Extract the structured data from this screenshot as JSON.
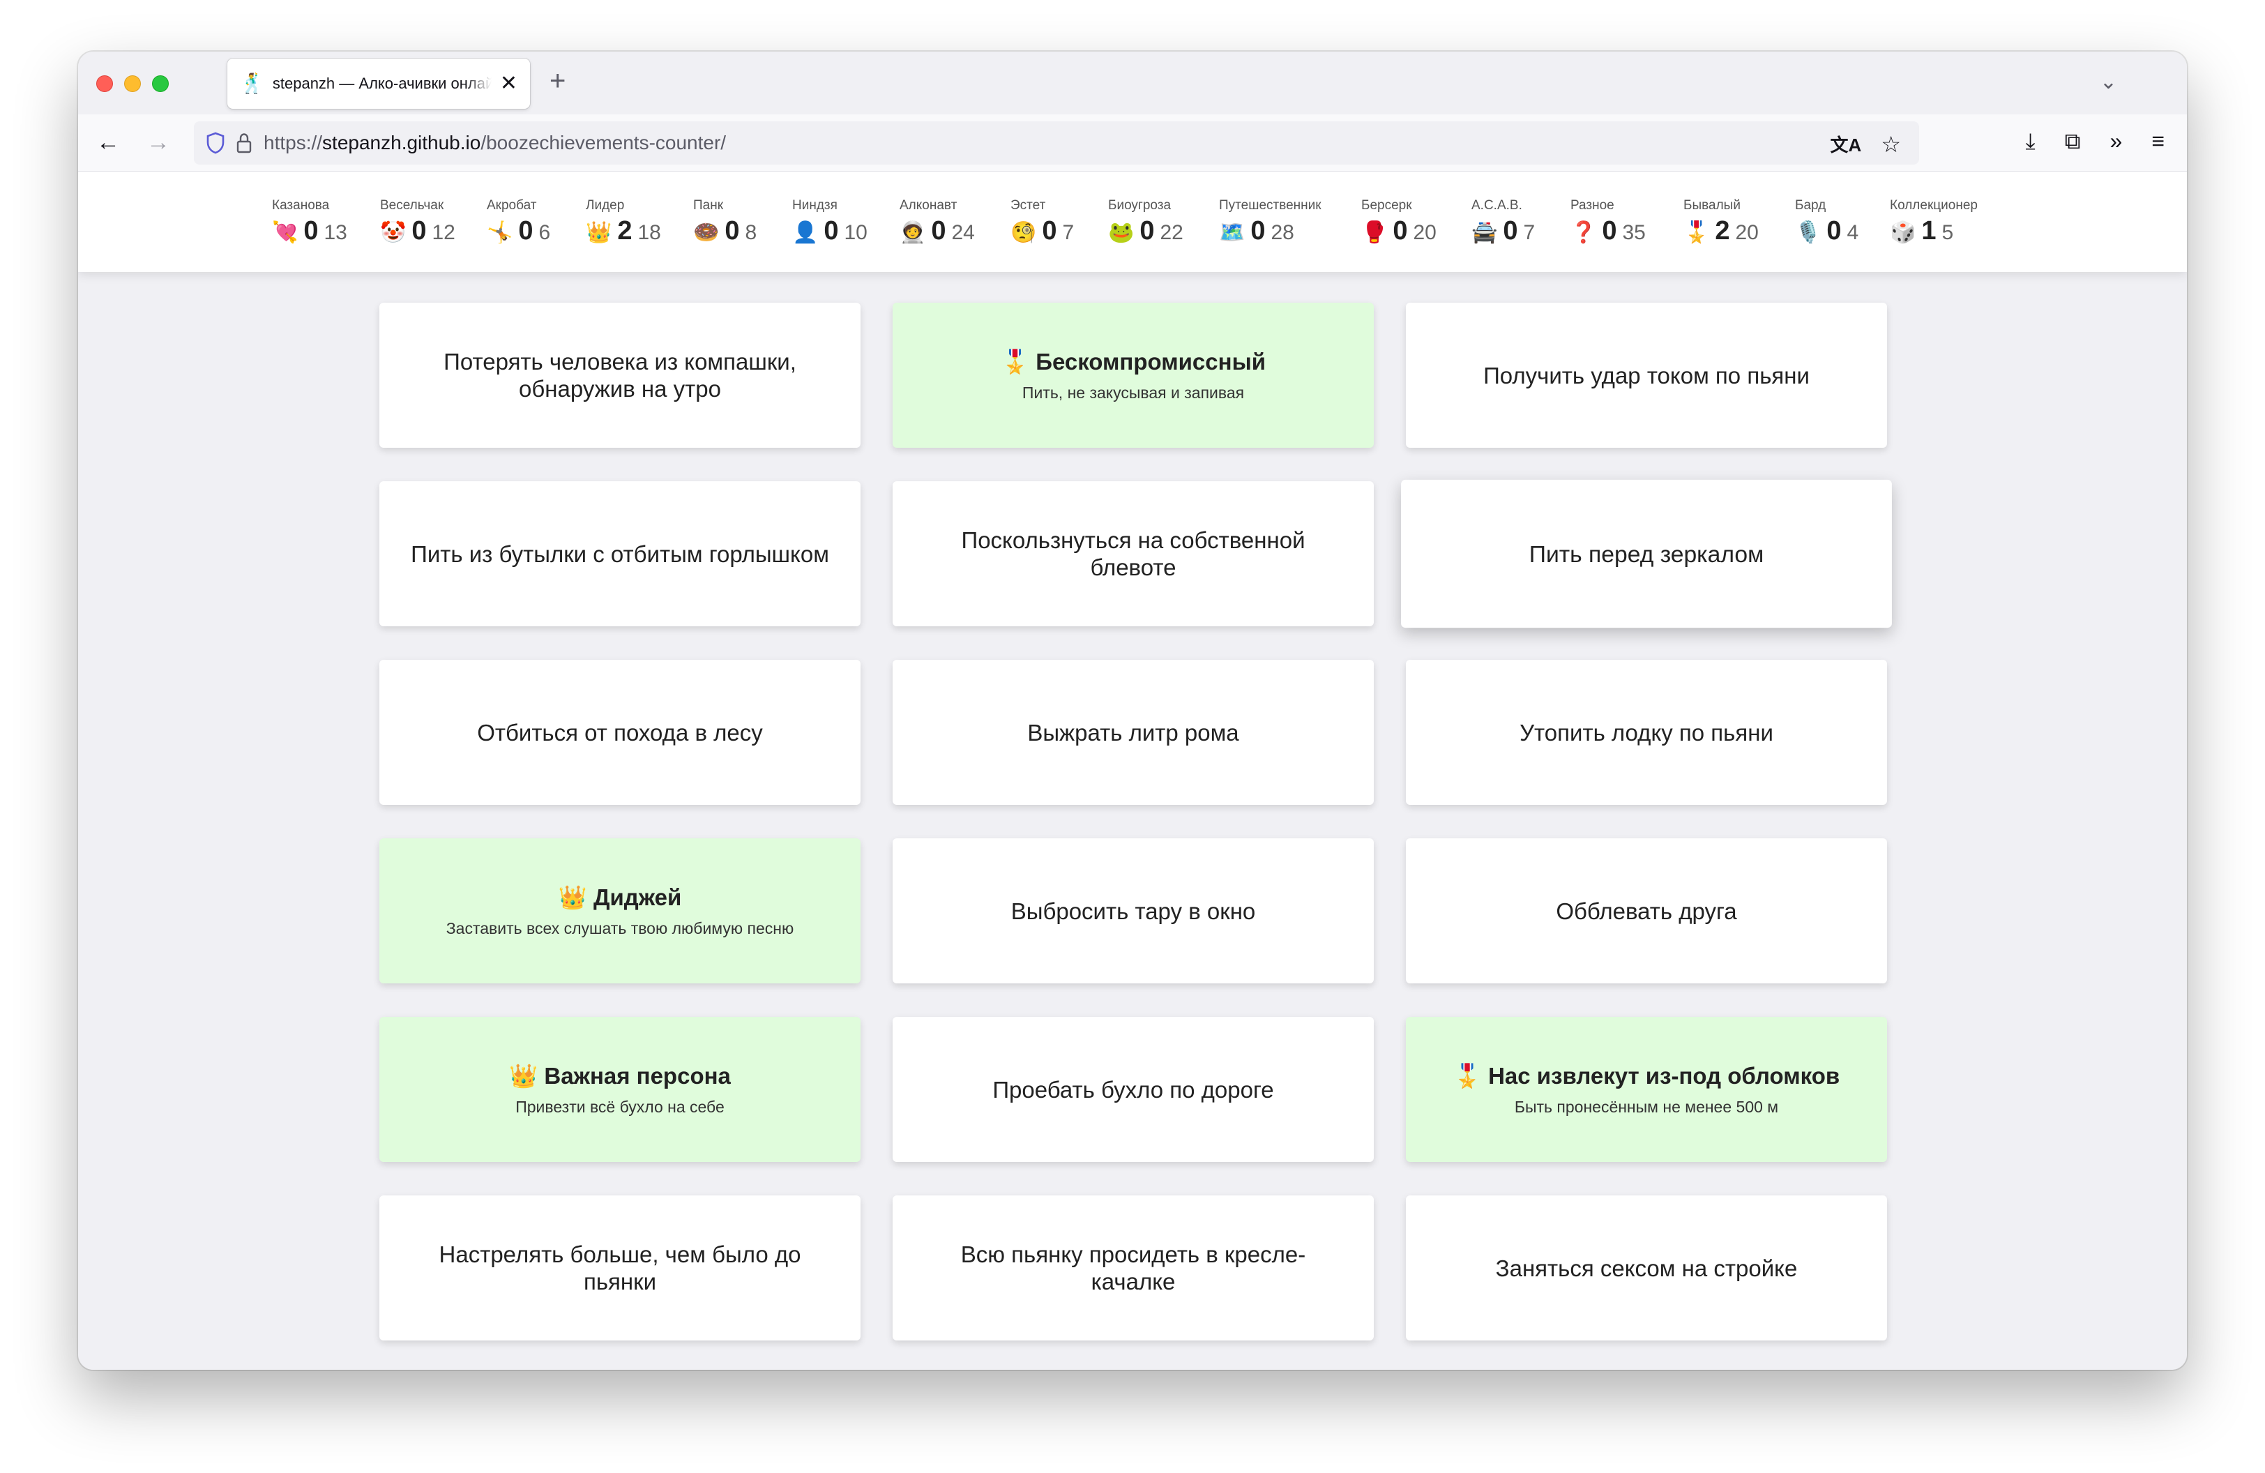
{
  "browser": {
    "tab_favicon": "🕺",
    "tab_title": "stepanzh — Алко-ачивки онлайн",
    "tab_close": "✕",
    "new_tab": "+",
    "tab_list": "⌄",
    "back": "←",
    "forward": "→",
    "url_prefix": "https://",
    "url_host": "stepanzh.github.io",
    "url_path": "/boozechievements-counter/",
    "translate_icon": "文A",
    "bookmark_icon": "☆",
    "download_icon": "⤓",
    "extensions_icon": "⧉",
    "overflow_icon": "»",
    "menu_icon": "≡"
  },
  "stats": [
    {
      "name": "Казанова",
      "icon": "💘",
      "count": "0",
      "total": "13"
    },
    {
      "name": "Весельчак",
      "icon": "🤡",
      "count": "0",
      "total": "12"
    },
    {
      "name": "Акробат",
      "icon": "🤸",
      "count": "0",
      "total": "6"
    },
    {
      "name": "Лидер",
      "icon": "👑",
      "count": "2",
      "total": "18"
    },
    {
      "name": "Панк",
      "icon": "🍩",
      "count": "0",
      "total": "8"
    },
    {
      "name": "Ниндзя",
      "icon": "👤",
      "count": "0",
      "total": "10"
    },
    {
      "name": "Алконавт",
      "icon": "🧑‍🚀",
      "count": "0",
      "total": "24"
    },
    {
      "name": "Эстет",
      "icon": "🧐",
      "count": "0",
      "total": "7"
    },
    {
      "name": "Биоугроза",
      "icon": "🐸",
      "count": "0",
      "total": "22"
    },
    {
      "name": "Путешественник",
      "icon": "🗺️",
      "count": "0",
      "total": "28"
    },
    {
      "name": "Берсерк",
      "icon": "🥊",
      "count": "0",
      "total": "20"
    },
    {
      "name": "A.C.A.B.",
      "icon": "🚔",
      "count": "0",
      "total": "7"
    },
    {
      "name": "Разное",
      "icon": "❓",
      "count": "0",
      "total": "35"
    },
    {
      "name": "Бывалый",
      "icon": "🎖️",
      "count": "2",
      "total": "20"
    },
    {
      "name": "Бард",
      "icon": "🎙️",
      "count": "0",
      "total": "4"
    },
    {
      "name": "Коллекционер",
      "icon": "🎲",
      "count": "1",
      "total": "5"
    }
  ],
  "cards": [
    {
      "text": "Потерять человека из компашки, обнаружив на утро",
      "done": false
    },
    {
      "icon": "🎖️",
      "title": "Бескомпромиссный",
      "desc": "Пить, не закусывая и запивая",
      "done": true
    },
    {
      "text": "Получить удар током по пьяни",
      "done": false
    },
    {
      "text": "Пить из бутылки с отбитым горлышком",
      "done": false
    },
    {
      "text": "Поскользнуться на собственной блевоте",
      "done": false
    },
    {
      "text": "Пить перед зеркалом",
      "done": false,
      "hover": true
    },
    {
      "text": "Отбиться от похода в лесу",
      "done": false
    },
    {
      "text": "Выжрать литр рома",
      "done": false
    },
    {
      "text": "Утопить лодку по пьяни",
      "done": false
    },
    {
      "icon": "👑",
      "title": "Диджей",
      "desc": "Заставить всех слушать твою любимую песню",
      "done": true
    },
    {
      "text": "Выбросить тару в окно",
      "done": false
    },
    {
      "text": "Обблевать друга",
      "done": false
    },
    {
      "icon": "👑",
      "title": "Важная персона",
      "desc": "Привезти всё бухло на себе",
      "done": true
    },
    {
      "text": "Проебать бухло по дороге",
      "done": false
    },
    {
      "icon": "🎖️",
      "title": "Нас извлекут из-под обломков",
      "desc": "Быть пронесённым не менее 500 м",
      "done": true
    },
    {
      "text": "Настрелять больше, чем было до пьянки",
      "done": false
    },
    {
      "text": "Всю пьянку просидеть в кресле-качалке",
      "done": false
    },
    {
      "text": "Заняться сексом на стройке",
      "done": false
    }
  ]
}
